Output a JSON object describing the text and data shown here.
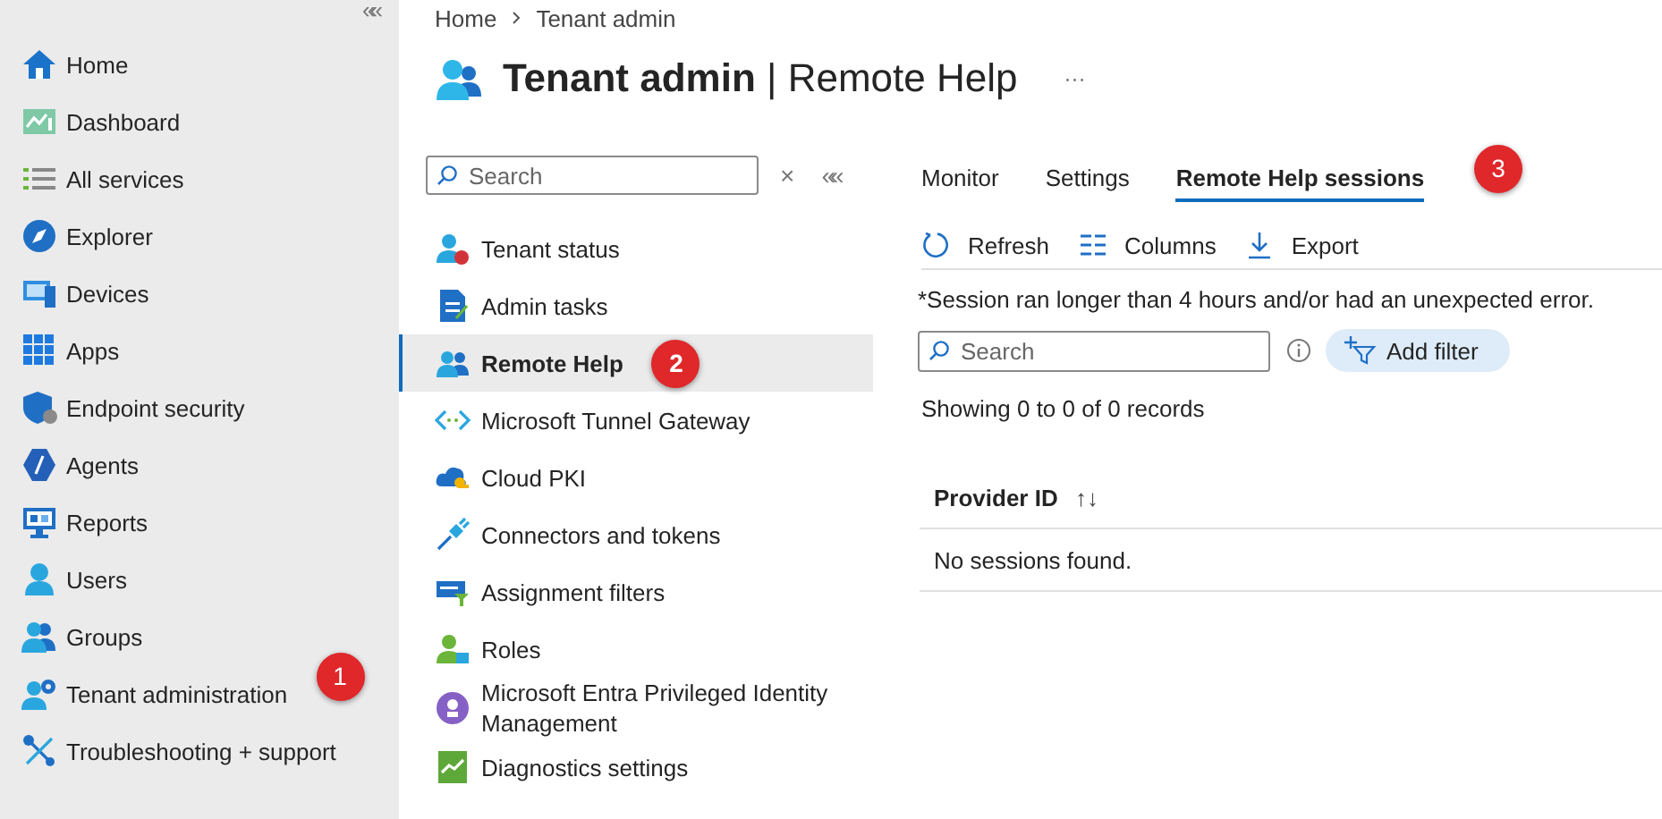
{
  "nav": {
    "collapse": "«",
    "items": [
      {
        "label": "Home"
      },
      {
        "label": "Dashboard"
      },
      {
        "label": "All services"
      },
      {
        "label": "Explorer"
      },
      {
        "label": "Devices"
      },
      {
        "label": "Apps"
      },
      {
        "label": "Endpoint security"
      },
      {
        "label": "Agents"
      },
      {
        "label": "Reports"
      },
      {
        "label": "Users"
      },
      {
        "label": "Groups"
      },
      {
        "label": "Tenant administration",
        "callout": "1"
      },
      {
        "label": "Troubleshooting + support"
      }
    ]
  },
  "breadcrumb": [
    "Home",
    "Tenant admin"
  ],
  "page_title": {
    "bold": "Tenant admin",
    "rest": "| Remote Help",
    "more": "···"
  },
  "resource_menu": {
    "search": {
      "placeholder": "Search"
    },
    "clear": "×",
    "collapse": "«",
    "items": [
      {
        "label": "Tenant status",
        "selected": false
      },
      {
        "label": "Admin tasks",
        "selected": false
      },
      {
        "label": "Remote Help",
        "selected": true,
        "callout": "2"
      },
      {
        "label": "Microsoft Tunnel Gateway",
        "selected": false
      },
      {
        "label": "Cloud PKI",
        "selected": false
      },
      {
        "label": "Connectors and tokens",
        "selected": false
      },
      {
        "label": "Assignment filters",
        "selected": false
      },
      {
        "label": "Roles",
        "selected": false
      },
      {
        "label": "Microsoft Entra Privileged Identity Management",
        "selected": false
      },
      {
        "label": "Diagnostics settings",
        "selected": false
      }
    ]
  },
  "tabs": {
    "items": [
      {
        "label": "Monitor",
        "selected": false
      },
      {
        "label": "Settings",
        "selected": false
      },
      {
        "label": "Remote Help sessions",
        "selected": true
      }
    ],
    "callout": "3"
  },
  "toolbar": [
    "Refresh",
    "Columns",
    "Export"
  ],
  "note": "*Session ran longer than 4 hours and/or had an unexpected error.",
  "filter": {
    "search": {
      "placeholder": "Search"
    },
    "add_filter": "Add filter"
  },
  "record_count": "Showing 0 to 0 of 0 records",
  "table": {
    "columns": [
      {
        "label": "Provider ID",
        "sort": "↑↓"
      }
    ],
    "empty": "No sessions found."
  }
}
